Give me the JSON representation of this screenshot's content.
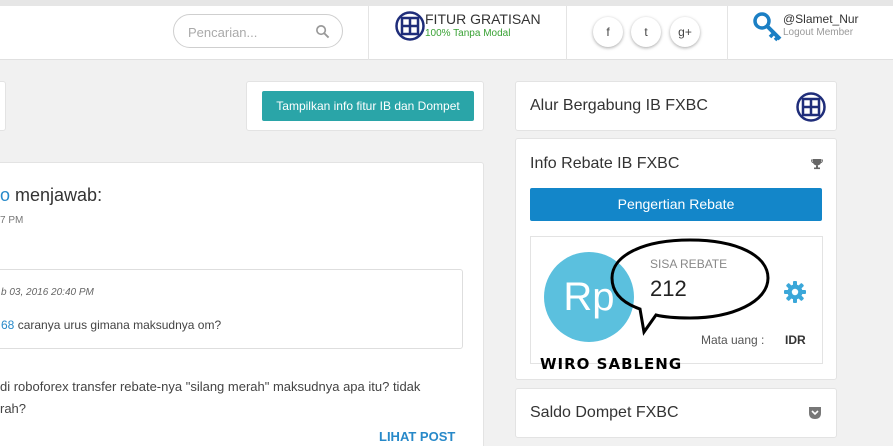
{
  "header": {
    "search": {
      "placeholder": "Pencarian..."
    },
    "fitur": {
      "title": "FITUR GRATISAN",
      "subtitle": "100% Tanpa Modal"
    },
    "social": [
      {
        "name": "facebook",
        "glyph": "f"
      },
      {
        "name": "twitter",
        "glyph": "t"
      },
      {
        "name": "google-plus",
        "glyph": "g+"
      }
    ],
    "user": {
      "username": "@Slamet_Nur",
      "logout_label": "Logout Member"
    }
  },
  "main": {
    "show_info_button": "Tampilkan info fitur IB dan Dompet",
    "answer": {
      "author_partial": "o",
      "action": " menjawab:",
      "time_partial": "7 PM"
    },
    "quote": {
      "date": "b 03, 2016 20:40 PM",
      "mention": "68",
      "text": " caranya urus gimana maksudnya om?"
    },
    "paragraph": "di roboforex transfer rebate-nya \"silang merah\" maksudnya apa itu? tidak\nrah?",
    "read_more": "LIHAT POST"
  },
  "sidebar": {
    "alur_title": "Alur Bergabung IB FXBC",
    "rebate_title": "Info Rebate IB FXBC",
    "pengertian_button": "Pengertian Rebate",
    "rebate": {
      "avatar_text": "Rp",
      "label": "SISA REBATE",
      "value": "212",
      "currency_label": "Mata uang :",
      "currency": "IDR",
      "stamp": "WIRO SABLENG"
    },
    "saldo_title": "Saldo Dompet FXBC"
  },
  "colors": {
    "teal": "#2aa5a8",
    "blue": "#1386c9",
    "avatar": "#5bc0de",
    "link": "#2789c9",
    "green": "#3aa235",
    "navy": "#1f2d7a"
  }
}
